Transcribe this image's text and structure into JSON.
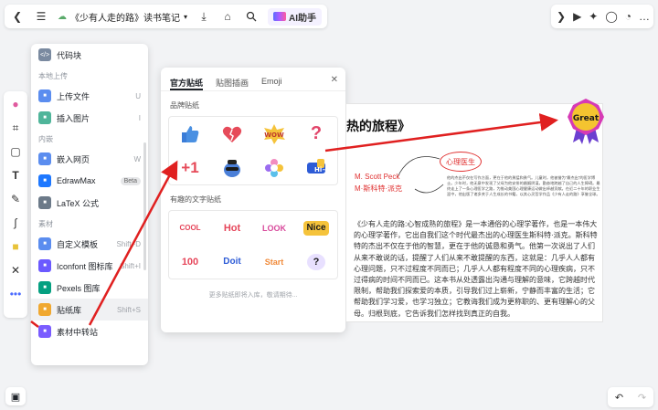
{
  "topbar": {
    "doc_title": "《少有人走的路》读书笔记",
    "ai_label": "AI助手"
  },
  "menu": {
    "top_item": "代码块",
    "sections": [
      {
        "title": "本地上传",
        "items": [
          {
            "label": "上传文件",
            "shortcut": "U",
            "icon": "upload-file-icon",
            "color": "#5b8def"
          },
          {
            "label": "插入图片",
            "shortcut": "I",
            "icon": "image-icon",
            "color": "#4fb59a"
          }
        ]
      },
      {
        "title": "内嵌",
        "items": [
          {
            "label": "嵌入网页",
            "shortcut": "W",
            "icon": "web-embed-icon",
            "color": "#5b8def"
          },
          {
            "label": "EdrawMax",
            "badge": "Beta",
            "icon": "edrawmax-icon",
            "color": "#1e78ff"
          },
          {
            "label": "LaTeX 公式",
            "icon": "latex-icon",
            "color": "#6c7a89"
          }
        ]
      },
      {
        "title": "素材",
        "items": [
          {
            "label": "自定义模板",
            "shortcut": "Shift+D",
            "icon": "template-icon",
            "color": "#5b8def"
          },
          {
            "label": "Iconfont 图标库",
            "shortcut": "Shift+I",
            "icon": "iconfont-icon",
            "color": "#6b59ff"
          },
          {
            "label": "Pexels 图库",
            "icon": "pexels-icon",
            "color": "#05a081"
          },
          {
            "label": "贴纸库",
            "shortcut": "Shift+S",
            "icon": "sticker-icon",
            "color": "#f0a830",
            "active": true
          },
          {
            "label": "素材中转站",
            "icon": "transfer-icon",
            "color": "#7a5cff"
          }
        ]
      }
    ]
  },
  "sticker_panel": {
    "tabs": [
      "官方贴纸",
      "贴图插画",
      "Emoji"
    ],
    "section1": "品牌贴纸",
    "section2": "有趣的文字贴纸",
    "more_text": "更多贴纸即将入库，敬请期待...",
    "text_stickers": [
      "COOL",
      "Hot",
      "LOOK",
      "Nice",
      "100",
      "Doit",
      "Start",
      "?"
    ]
  },
  "canvas": {
    "heading": "热的旅程》",
    "bubble": "心理医生",
    "author_en": "M. Scott Peck",
    "author_cn": "M·斯科特·派克",
    "small_text": "他的杰出不仅在写作方面，更在于他的勇猛和勇气。儿童时，他被誉为\"最杰出\"的医学博士。少年时，他无意中发现了父母为他安排的婚姻阴谋，勤奋地跨越了自己的人生障碍。最终走上了一条心理医学之路，为推动美国心理健康运动做出卓越贡献。在近二十年的职业生涯中，他出版了诸多关于人生成长的书籍，以其心灵哲学作品《少有人走的路》享誉全球。",
    "body": "《少有人走的路:心智成熟的旅程》是一本通俗的心理学著作，也是一本伟大的心理学著作，它出自我们这个时代最杰出的心理医生斯科特·派克。斯科特特的杰出不仅在于他的智慧，更在于他的诚恳和勇气。他第一次说出了人们从来不敢说的话，提醒了人们从来不敢提醒的东西，这就是：几乎人人都有心理问题，只不过程度不同而已；几乎人人都有程度不同的心理疾病，只不过得病的时间不同而已。这本书从处透露出沟通与理解的意味，它跨越时代限制，帮助我们探索爱的本质，引导我们过上崭新，宁静而丰富的生活；它帮助我们学习爱，也学习独立；它教诲我们成为更称职的、更有理解心的父母。归根到底，它告诉我们怎样找到真正的自我。",
    "badge_text": "Great"
  },
  "colors": {
    "arrow": "#e02020",
    "accent": "#1f2329",
    "badge_fill": "#f4c430",
    "badge_ring": "#d63ab5"
  }
}
